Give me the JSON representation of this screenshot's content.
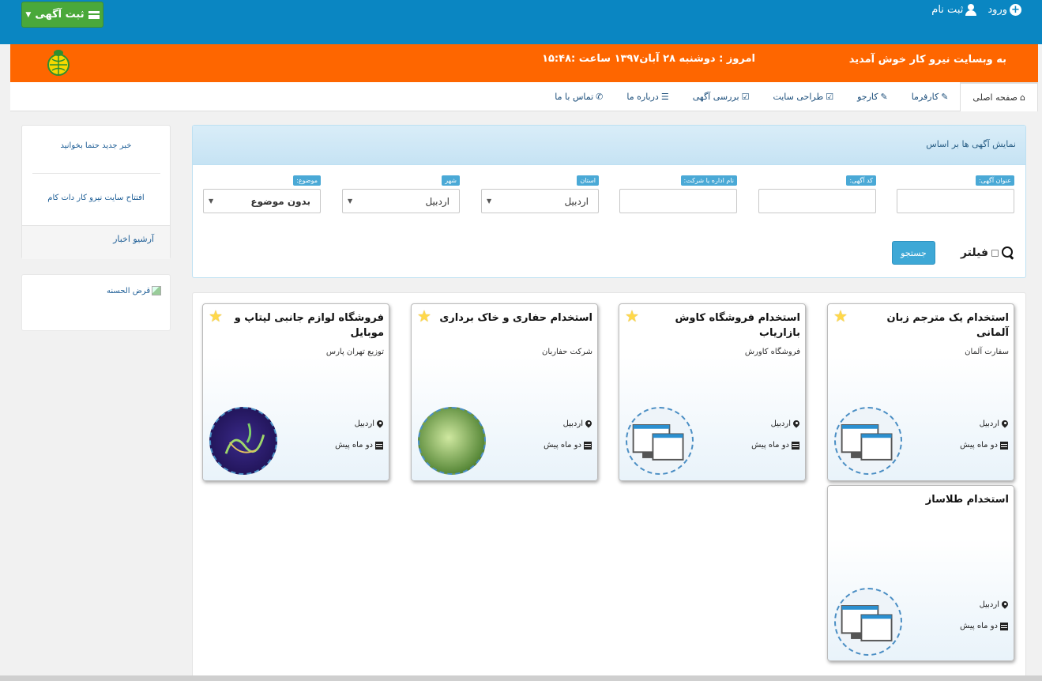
{
  "topbar": {
    "post_ad_label": "ثبت آگهی",
    "login_label": "ورود",
    "register_label": "ثبت نام"
  },
  "orangebar": {
    "welcome": "به وبسایت نیرو کار خوش آمدید",
    "today": "امروز : دوشنبه ۲۸ آبان۱۳۹۷ ساعت :۱۵:۴۸"
  },
  "nav": {
    "items": [
      {
        "label": "صفحه اصلی",
        "icon": "home-icon"
      },
      {
        "label": "کارفرما",
        "icon": "pin-icon"
      },
      {
        "label": "کارجو",
        "icon": "pin-icon"
      },
      {
        "label": "طراحی سایت",
        "icon": "edit-icon"
      },
      {
        "label": "بررسی آگهی",
        "icon": "check-icon"
      },
      {
        "label": "درباره ما",
        "icon": "user-stack-icon"
      },
      {
        "label": "تماس با ما",
        "icon": "phone-icon"
      }
    ]
  },
  "sidebar": {
    "news1": "خبر جدید حتما بخوانید",
    "news2": "افتتاح سایت نیرو کار دات کام",
    "archive": "آرشیو اخبار",
    "image_alt": "قرض الحسنه"
  },
  "filter": {
    "title": "نمایش آگهی ها بر اساس",
    "fields": {
      "ad_title": {
        "label": "عنوان آگهی:",
        "value": ""
      },
      "ad_code": {
        "label": "کد آگهی:",
        "value": ""
      },
      "company": {
        "label": "نام اداره یا شرکت:",
        "value": ""
      },
      "province": {
        "label": "استان",
        "value": "اردبیل"
      },
      "city": {
        "label": "شهر",
        "value": "اردبیل"
      },
      "subject": {
        "label": "موضوع:",
        "value": "بدون موضوع"
      }
    },
    "filter_label": "فیلتر",
    "search_button": "جستجو"
  },
  "listings": [
    {
      "title": "استخدام یک مترجم زبان آلمانی",
      "company": "سفارت آلمان",
      "city": "اردبیل",
      "date": "دو ماه پیش",
      "thumb": "computer-screens"
    },
    {
      "title": "استخدام فروشگاه کاوش بازاریاب",
      "company": "فروشگاه کاورش",
      "city": "اردبیل",
      "date": "دو ماه پیش",
      "thumb": "computer-screens"
    },
    {
      "title": "استخدام حفاری و خاک برداری",
      "company": "شرکت حفاربان",
      "city": "اردبیل",
      "date": "دو ماه پیش",
      "thumb": "green-plant"
    },
    {
      "title": "فروشگاه لوازم جانبی لپتاپ و موبایل",
      "company": "توزیع تهران پارس",
      "city": "اردبیل",
      "date": "دو ماه پیش",
      "thumb": "calligraphy"
    },
    {
      "title": "استخدام طلاساز",
      "company": "",
      "city": "اردبیل",
      "date": "دو ماه پیش",
      "thumb": "computer-screens"
    }
  ],
  "colors": {
    "topbar": "#0a86c2",
    "orangebar": "#fe6600",
    "post_ad_button": "#4aa83a",
    "search_button": "#3ea8d6"
  }
}
